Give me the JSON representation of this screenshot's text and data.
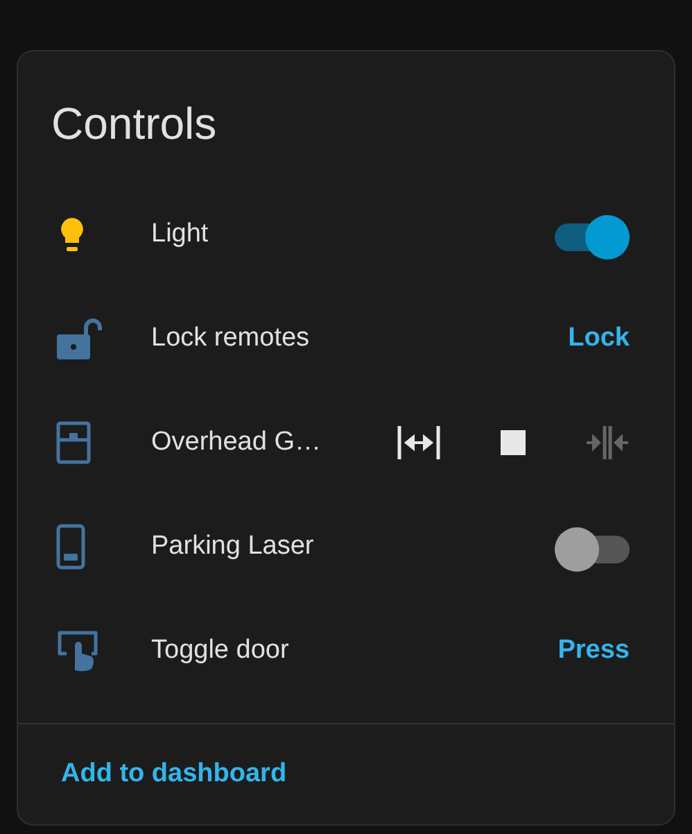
{
  "card": {
    "title": "Controls",
    "rows": [
      {
        "kind": "toggle",
        "name": "Light",
        "on": true
      },
      {
        "kind": "button",
        "name": "Lock remotes",
        "action": "Lock"
      },
      {
        "kind": "cover",
        "name": "Overhead G…",
        "buttons": [
          {
            "disabled": false
          },
          {
            "disabled": false
          },
          {
            "disabled": true
          }
        ]
      },
      {
        "kind": "toggle",
        "name": "Parking Laser",
        "on": false
      },
      {
        "kind": "button",
        "name": "Toggle door",
        "action": "Press"
      }
    ],
    "footer": {
      "link": "Add to dashboard"
    }
  }
}
